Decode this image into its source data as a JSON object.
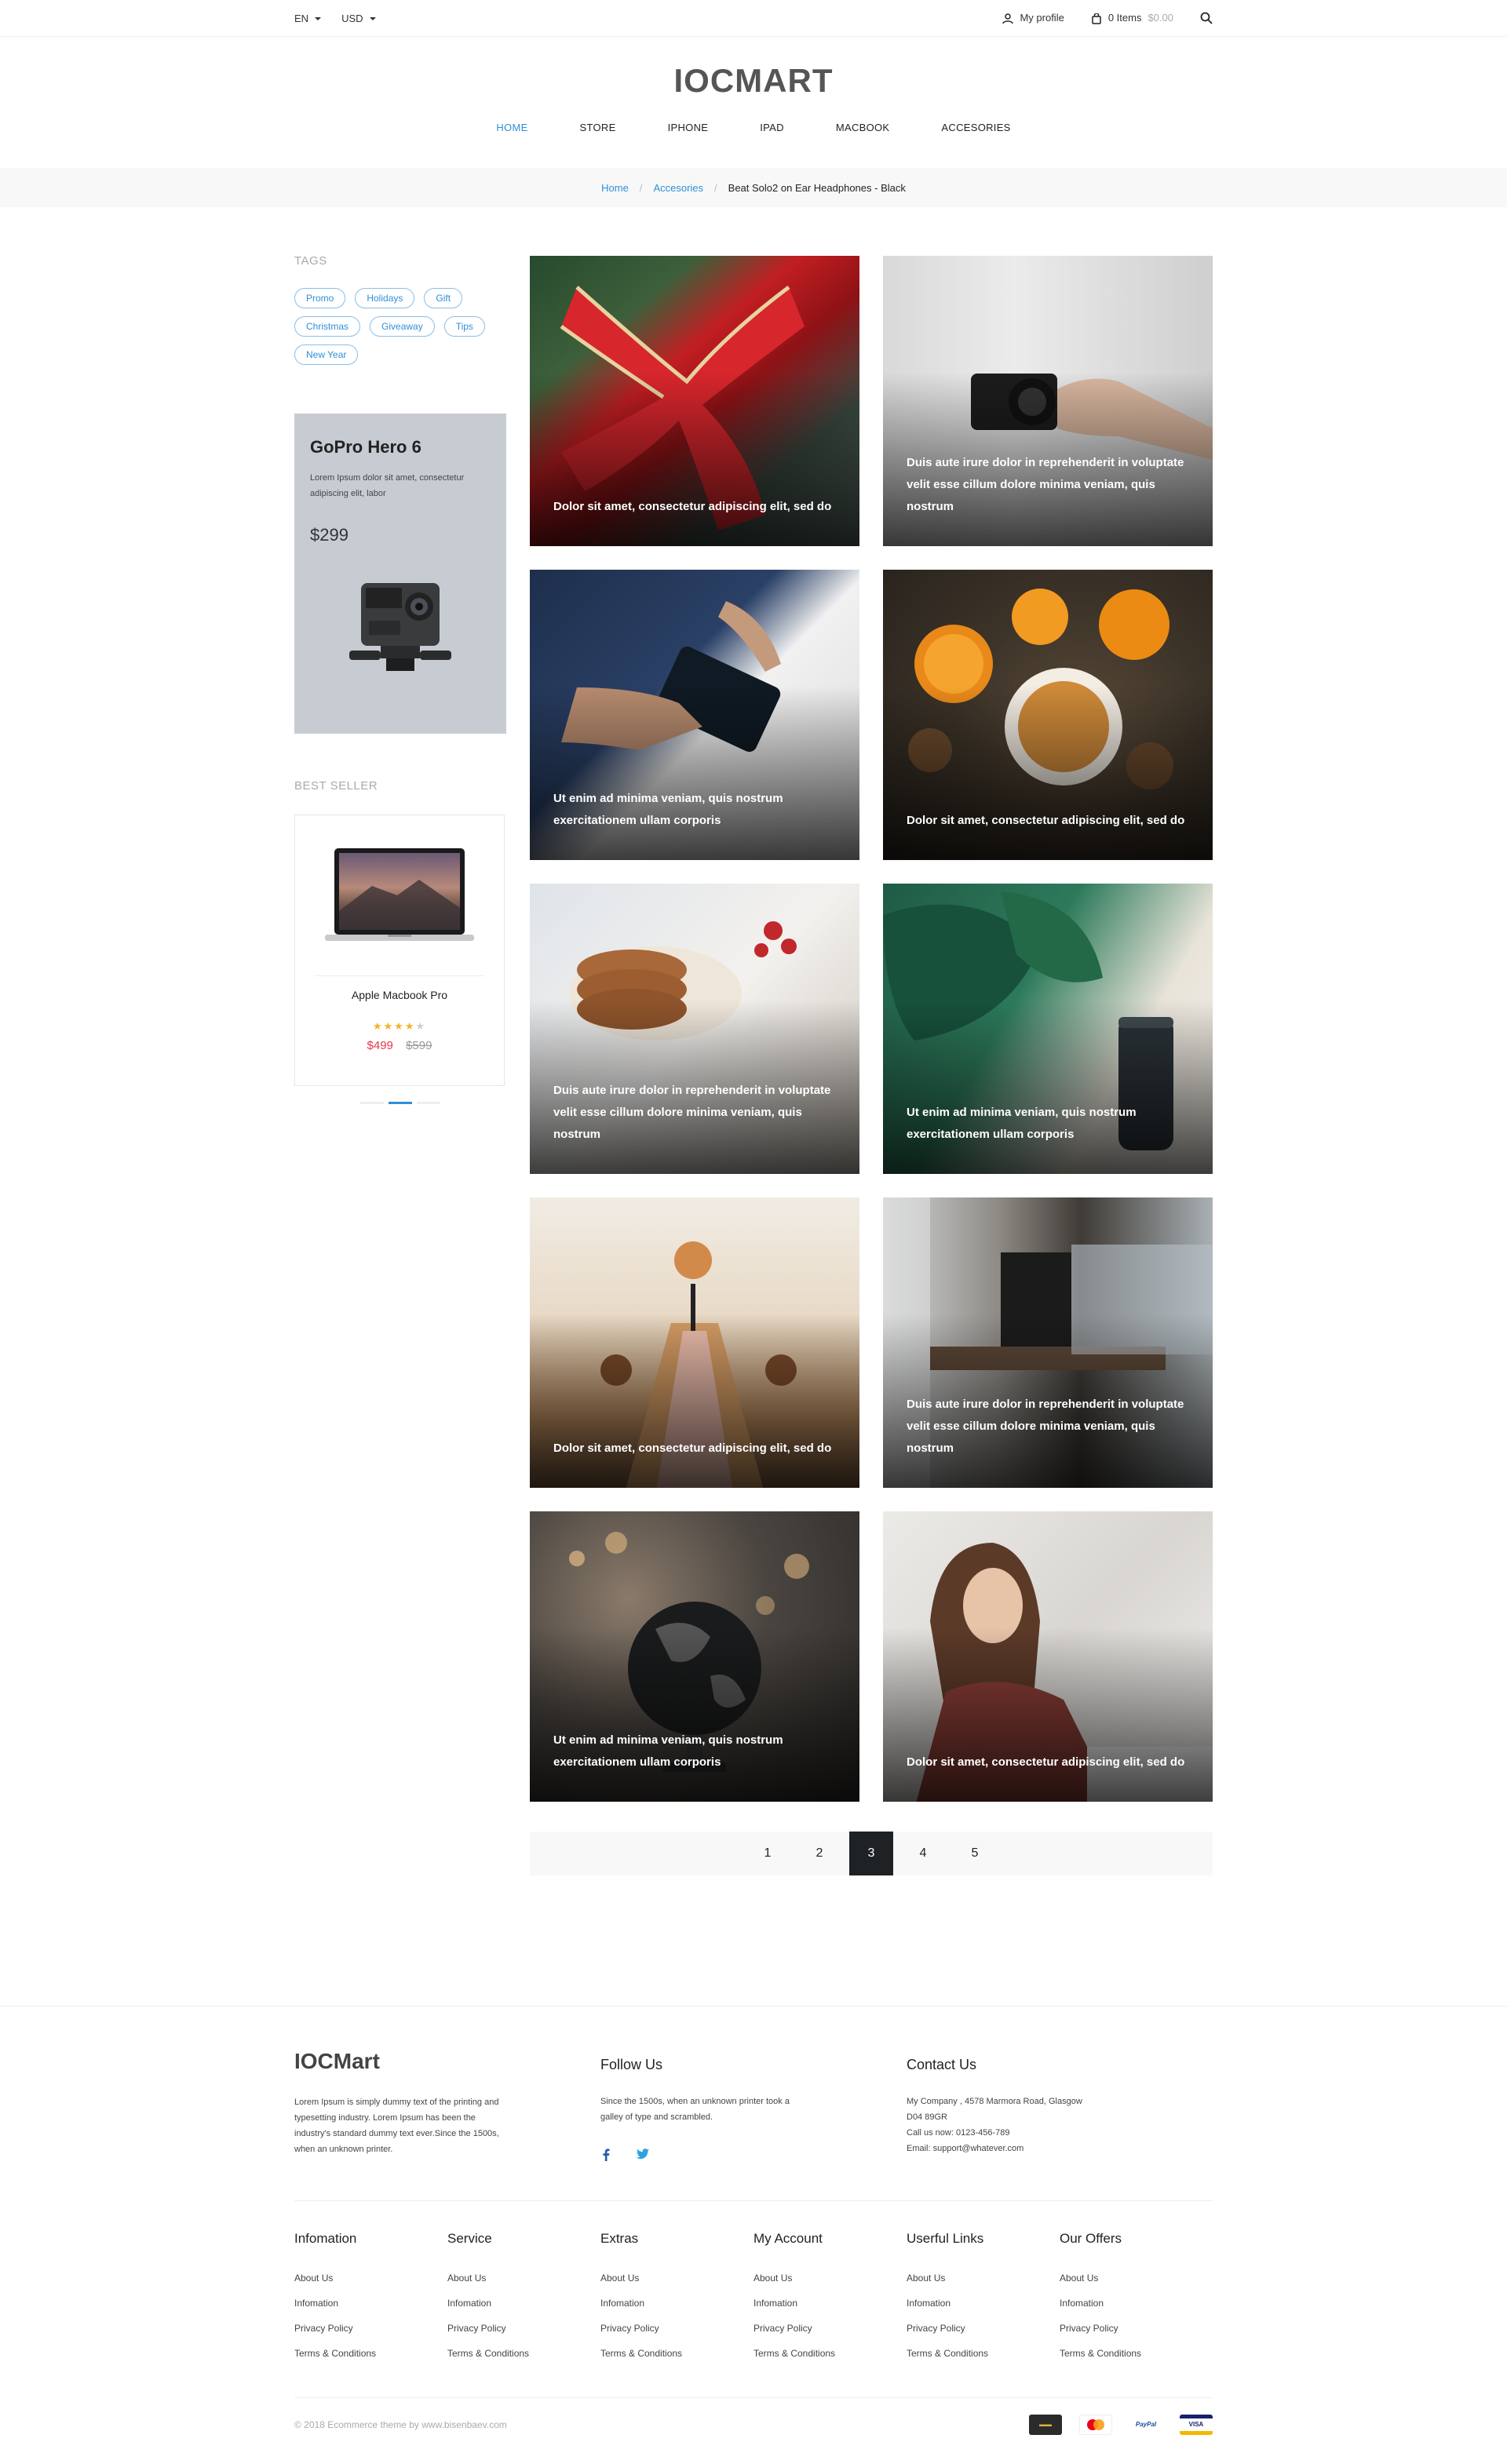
{
  "topbar": {
    "language": "EN",
    "currency": "USD",
    "profile_label": "My profile",
    "cart_items": "0 Items",
    "cart_total": "$0.00"
  },
  "header": {
    "logo": "IOCMART",
    "nav": [
      {
        "label": "HOME",
        "active": true
      },
      {
        "label": "STORE"
      },
      {
        "label": "IPHONE"
      },
      {
        "label": "IPAD"
      },
      {
        "label": "MACBOOK"
      },
      {
        "label": "ACCESORIES"
      }
    ]
  },
  "breadcrumb": {
    "home": "Home",
    "category": "Accesories",
    "current": "Beat Solo2 on Ear Headphones - Black"
  },
  "sidebar": {
    "tags_title": "TAGS",
    "tags": [
      "Promo",
      "Holidays",
      "Gift",
      "Christmas",
      "Giveaway",
      "Tips",
      "New Year"
    ],
    "promo": {
      "title": "GoPro Hero 6",
      "text": "Lorem Ipsum dolor sit amet, consectetur adipiscing elit, labor",
      "price": "$299"
    },
    "best_seller_title": "BEST SELLER",
    "product": {
      "name": "Apple Macbook Pro",
      "rating": 4,
      "price": "$499",
      "old_price": "$599"
    }
  },
  "posts": [
    {
      "caption": "Dolor sit amet, consectetur adipiscing elit, sed do",
      "image": "red christmas bow on tree"
    },
    {
      "caption": "Duis aute irure dolor in reprehenderit in voluptate velit esse cillum dolore minima veniam, quis nostrum",
      "image": "hand holding camera"
    },
    {
      "caption": "Ut enim ad minima veniam, quis nostrum exercitationem ullam corporis",
      "image": "man holding wallet"
    },
    {
      "caption": "Dolor sit amet, consectetur adipiscing elit, sed do",
      "image": "oranges and tea"
    },
    {
      "caption": "Duis aute irure dolor in reprehenderit in voluptate velit esse cillum dolore minima veniam, quis nostrum",
      "image": "cookies on plate"
    },
    {
      "caption": "Ut enim ad minima veniam, quis nostrum exercitationem ullam corporis",
      "image": "monstera leaves and speaker"
    },
    {
      "caption": "Dolor sit amet, consectetur adipiscing elit, sed do",
      "image": "dining table with candles"
    },
    {
      "caption": "Duis aute irure dolor in reprehenderit in voluptate velit esse cillum dolore minima veniam, quis nostrum",
      "image": "cafe coffee counter"
    },
    {
      "caption": "Ut enim ad minima veniam, quis nostrum exercitationem ullam corporis",
      "image": "black globe with bokeh"
    },
    {
      "caption": "Dolor sit amet, consectetur adipiscing elit, sed do",
      "image": "woman with glasses"
    }
  ],
  "pagination": {
    "pages": [
      "1",
      "2",
      "3",
      "4",
      "5"
    ],
    "current": "3"
  },
  "footer": {
    "brand": "IOCMart",
    "brand_text": "Lorem Ipsum is simply dummy text of the printing and typesetting industry. Lorem Ipsum has been the industry's standard dummy text ever.Since the 1500s, when an unknown printer.",
    "follow_title": "Follow Us",
    "follow_text": "Since the 1500s, when an unknown printer took a galley of type and scrambled.",
    "contact_title": "Contact Us",
    "contact_lines": [
      "My Company , 4578 Marmora Road, Glasgow",
      "D04 89GR",
      "Call us now: 0123-456-789",
      "Email: support@whatever.com"
    ],
    "link_columns": [
      {
        "title": "Infomation",
        "links": [
          "About Us",
          "Infomation",
          "Privacy Policy",
          "Terms & Conditions"
        ]
      },
      {
        "title": "Service",
        "links": [
          "About Us",
          "Infomation",
          "Privacy Policy",
          "Terms & Conditions"
        ]
      },
      {
        "title": "Extras",
        "links": [
          "About Us",
          "Infomation",
          "Privacy Policy",
          "Terms & Conditions"
        ]
      },
      {
        "title": "My Account",
        "links": [
          "About Us",
          "Infomation",
          "Privacy Policy",
          "Terms & Conditions"
        ]
      },
      {
        "title": "Userful Links",
        "links": [
          "About Us",
          "Infomation",
          "Privacy Policy",
          "Terms & Conditions"
        ]
      },
      {
        "title": "Our Offers",
        "links": [
          "About Us",
          "Infomation",
          "Privacy Policy",
          "Terms & Conditions"
        ]
      }
    ],
    "copyright": "© 2018 Ecommerce theme by www.bisenbaev.com",
    "payments": [
      "paypal-card",
      "mastercard",
      "PayPal",
      "VISA"
    ]
  },
  "colors": {
    "accent": "#2f8fd8",
    "sale": "#e6374b",
    "star": "#f3b229",
    "dark": "#1f2225"
  }
}
